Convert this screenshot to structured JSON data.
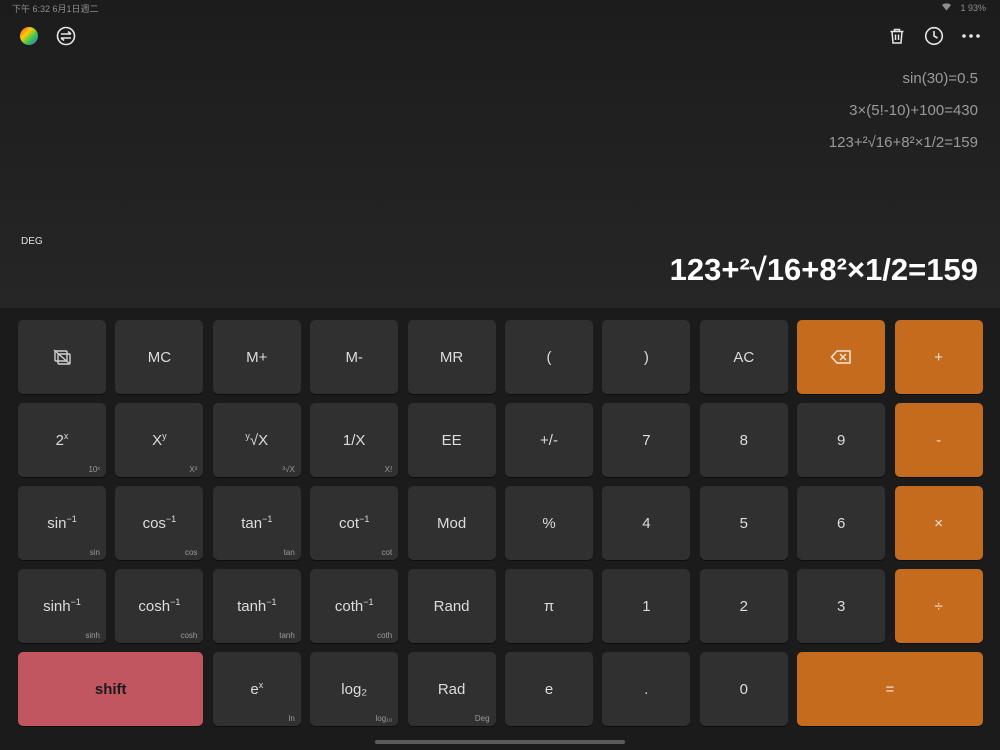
{
  "status": {
    "time": "下午 6:32",
    "date": "6月1日週二",
    "right": "1 93% "
  },
  "toolbar": {
    "left_icons": [
      "color-wheel-icon",
      "swap-icon"
    ],
    "right_icons": [
      "trash-icon",
      "history-clock-icon",
      "more-icon"
    ]
  },
  "display": {
    "history": [
      "sin(30)=0.5",
      "3×(5!-10)+100=430",
      "123+²√16+8²×1/2=159"
    ],
    "angle_mode": "DEG",
    "result": "123+²√16+8²×1/2=159"
  },
  "colors": {
    "accent": "#c56b1e",
    "shift": "#c25660",
    "key": "#303030",
    "background": "#181818"
  },
  "keys": [
    [
      {
        "name": "hide-history-icon",
        "label": "",
        "icon": "hide-history-icon"
      },
      {
        "name": "mc",
        "label": "MC"
      },
      {
        "name": "m-plus",
        "label": "M+"
      },
      {
        "name": "m-minus",
        "label": "M-"
      },
      {
        "name": "mr",
        "label": "MR"
      },
      {
        "name": "open-paren",
        "label": "("
      },
      {
        "name": "close-paren",
        "label": ")"
      },
      {
        "name": "ac",
        "label": "AC"
      },
      {
        "name": "backspace",
        "label": "",
        "icon": "backspace-icon",
        "style": "orange"
      },
      {
        "name": "plus",
        "label": "+",
        "style": "orange"
      }
    ],
    [
      {
        "name": "two-pow-x",
        "label": "2",
        "sup": "x",
        "sub": "10ˣ"
      },
      {
        "name": "x-pow-y",
        "label": "X",
        "sup": "y",
        "sub": "X²"
      },
      {
        "name": "y-root-x",
        "label": "√X",
        "pre": "y",
        "sub": "³√X"
      },
      {
        "name": "reciprocal",
        "label": "1/X",
        "sub": "X!"
      },
      {
        "name": "ee",
        "label": "EE"
      },
      {
        "name": "plus-minus",
        "label": "+/-"
      },
      {
        "name": "seven",
        "label": "7"
      },
      {
        "name": "eight",
        "label": "8"
      },
      {
        "name": "nine",
        "label": "9"
      },
      {
        "name": "minus",
        "label": "-",
        "style": "orange"
      }
    ],
    [
      {
        "name": "asin",
        "label": "sin",
        "sup": "−1",
        "sub": "sin"
      },
      {
        "name": "acos",
        "label": "cos",
        "sup": "−1",
        "sub": "cos"
      },
      {
        "name": "atan",
        "label": "tan",
        "sup": "−1",
        "sub": "tan"
      },
      {
        "name": "acot",
        "label": "cot",
        "sup": "−1",
        "sub": "cot"
      },
      {
        "name": "mod",
        "label": "Mod"
      },
      {
        "name": "percent",
        "label": "%"
      },
      {
        "name": "four",
        "label": "4"
      },
      {
        "name": "five",
        "label": "5"
      },
      {
        "name": "six",
        "label": "6"
      },
      {
        "name": "multiply",
        "label": "×",
        "style": "orange"
      }
    ],
    [
      {
        "name": "asinh",
        "label": "sinh",
        "sup": "−1",
        "sub": "sinh"
      },
      {
        "name": "acosh",
        "label": "cosh",
        "sup": "−1",
        "sub": "cosh"
      },
      {
        "name": "atanh",
        "label": "tanh",
        "sup": "−1",
        "sub": "tanh"
      },
      {
        "name": "acoth",
        "label": "coth",
        "sup": "−1",
        "sub": "coth"
      },
      {
        "name": "rand",
        "label": "Rand"
      },
      {
        "name": "pi",
        "label": "π"
      },
      {
        "name": "one",
        "label": "1"
      },
      {
        "name": "two",
        "label": "2"
      },
      {
        "name": "three",
        "label": "3"
      },
      {
        "name": "divide",
        "label": "÷",
        "style": "orange"
      }
    ],
    [
      {
        "name": "shift",
        "label": "shift",
        "style": "red",
        "span": 2
      },
      {
        "name": "e-pow-x",
        "label": "e",
        "sup": "x",
        "sub": "ln"
      },
      {
        "name": "log2",
        "label": "log₂",
        "sub": "log₁₀"
      },
      {
        "name": "rad",
        "label": "Rad",
        "sub": "Deg"
      },
      {
        "name": "e-const",
        "label": "e"
      },
      {
        "name": "decimal",
        "label": "."
      },
      {
        "name": "zero",
        "label": "0"
      },
      {
        "name": "equals",
        "label": "=",
        "style": "orange",
        "span": 2
      }
    ]
  ]
}
